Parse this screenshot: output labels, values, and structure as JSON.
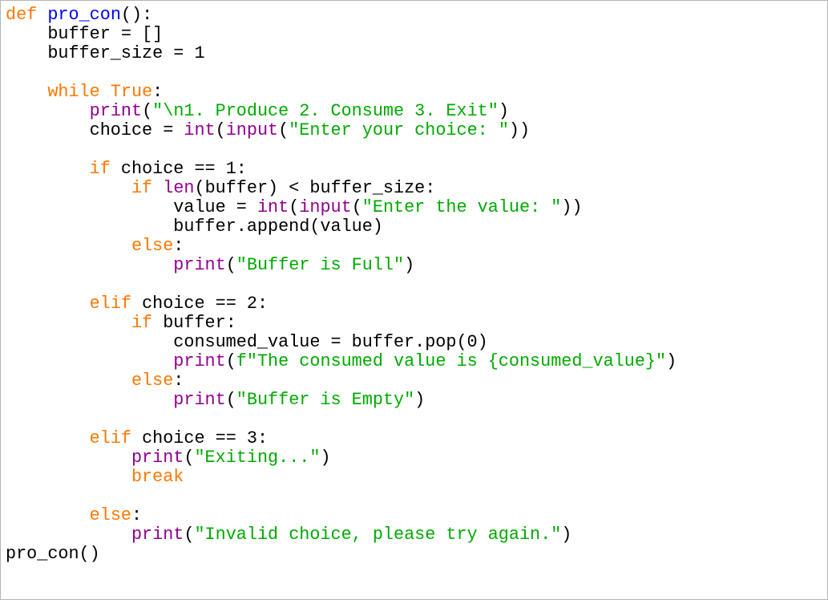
{
  "colors": {
    "keyword": "#ff7700",
    "builtin": "#900090",
    "string": "#00aa00",
    "definition": "#0000ff",
    "default": "#000000",
    "background": "#ffffff"
  },
  "lines": [
    [
      [
        "kw",
        "def"
      ],
      [
        "t",
        " "
      ],
      [
        "df",
        "pro_con"
      ],
      [
        "t",
        "():"
      ]
    ],
    [
      [
        "t",
        "    buffer = []"
      ]
    ],
    [
      [
        "t",
        "    buffer_size = 1"
      ]
    ],
    [],
    [
      [
        "t",
        "    "
      ],
      [
        "kw",
        "while"
      ],
      [
        "t",
        " "
      ],
      [
        "kw",
        "True"
      ],
      [
        "t",
        ":"
      ]
    ],
    [
      [
        "t",
        "        "
      ],
      [
        "bi",
        "print"
      ],
      [
        "t",
        "("
      ],
      [
        "st",
        "\"\\n1. Produce 2. Consume 3. Exit\""
      ],
      [
        "t",
        ")"
      ]
    ],
    [
      [
        "t",
        "        choice = "
      ],
      [
        "bi",
        "int"
      ],
      [
        "t",
        "("
      ],
      [
        "bi",
        "input"
      ],
      [
        "t",
        "("
      ],
      [
        "st",
        "\"Enter your choice: \""
      ],
      [
        "t",
        "))"
      ]
    ],
    [],
    [
      [
        "t",
        "        "
      ],
      [
        "kw",
        "if"
      ],
      [
        "t",
        " choice == 1:"
      ]
    ],
    [
      [
        "t",
        "            "
      ],
      [
        "kw",
        "if"
      ],
      [
        "t",
        " "
      ],
      [
        "bi",
        "len"
      ],
      [
        "t",
        "(buffer) < buffer_size:"
      ]
    ],
    [
      [
        "t",
        "                value = "
      ],
      [
        "bi",
        "int"
      ],
      [
        "t",
        "("
      ],
      [
        "bi",
        "input"
      ],
      [
        "t",
        "("
      ],
      [
        "st",
        "\"Enter the value: \""
      ],
      [
        "t",
        "))"
      ]
    ],
    [
      [
        "t",
        "                buffer.append(value)"
      ]
    ],
    [
      [
        "t",
        "            "
      ],
      [
        "kw",
        "else"
      ],
      [
        "t",
        ":"
      ]
    ],
    [
      [
        "t",
        "                "
      ],
      [
        "bi",
        "print"
      ],
      [
        "t",
        "("
      ],
      [
        "st",
        "\"Buffer is Full\""
      ],
      [
        "t",
        ")"
      ]
    ],
    [],
    [
      [
        "t",
        "        "
      ],
      [
        "kw",
        "elif"
      ],
      [
        "t",
        " choice == 2:"
      ]
    ],
    [
      [
        "t",
        "            "
      ],
      [
        "kw",
        "if"
      ],
      [
        "t",
        " buffer:"
      ]
    ],
    [
      [
        "t",
        "                consumed_value = buffer.pop(0)"
      ]
    ],
    [
      [
        "t",
        "                "
      ],
      [
        "bi",
        "print"
      ],
      [
        "t",
        "("
      ],
      [
        "st",
        "f\"The consumed value is {consumed_value}\""
      ],
      [
        "t",
        ")"
      ]
    ],
    [
      [
        "t",
        "            "
      ],
      [
        "kw",
        "else"
      ],
      [
        "t",
        ":"
      ]
    ],
    [
      [
        "t",
        "                "
      ],
      [
        "bi",
        "print"
      ],
      [
        "t",
        "("
      ],
      [
        "st",
        "\"Buffer is Empty\""
      ],
      [
        "t",
        ")"
      ]
    ],
    [],
    [
      [
        "t",
        "        "
      ],
      [
        "kw",
        "elif"
      ],
      [
        "t",
        " choice == 3:"
      ]
    ],
    [
      [
        "t",
        "            "
      ],
      [
        "bi",
        "print"
      ],
      [
        "t",
        "("
      ],
      [
        "st",
        "\"Exiting...\""
      ],
      [
        "t",
        ")"
      ]
    ],
    [
      [
        "t",
        "            "
      ],
      [
        "kw",
        "break"
      ]
    ],
    [],
    [
      [
        "t",
        "        "
      ],
      [
        "kw",
        "else"
      ],
      [
        "t",
        ":"
      ]
    ],
    [
      [
        "t",
        "            "
      ],
      [
        "bi",
        "print"
      ],
      [
        "t",
        "("
      ],
      [
        "st",
        "\"Invalid choice, please try again.\""
      ],
      [
        "t",
        ")"
      ]
    ],
    [
      [
        "t",
        "pro_con()"
      ]
    ]
  ]
}
